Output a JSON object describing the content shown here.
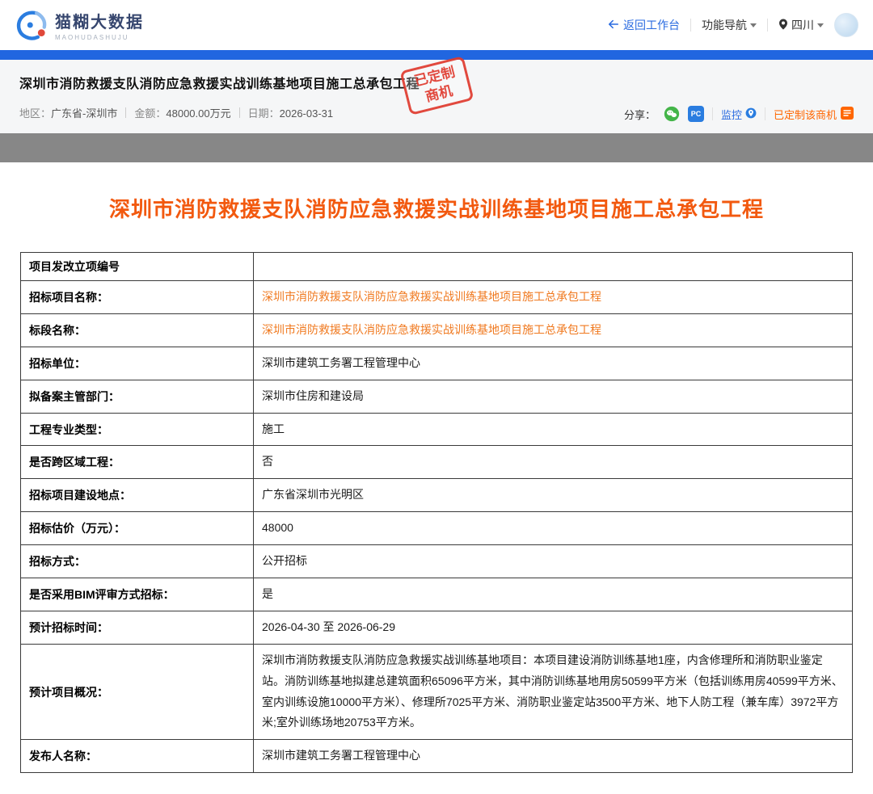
{
  "header": {
    "logo": {
      "title": "猫糊大数据",
      "subtitle": "MAOHUDASHUJU"
    },
    "nav": {
      "back_label": "返回工作台",
      "features_label": "功能导航",
      "region_label": "四川"
    }
  },
  "hero": {
    "title": "深圳市消防救援支队消防应急救援实战训练基地项目施工总承包工程",
    "stamp": {
      "line1": "已定制",
      "line2": "商机"
    },
    "meta": [
      {
        "label": "地区：",
        "value": "广东省-深圳市"
      },
      {
        "label": "金额：",
        "value": "48000.00万元"
      },
      {
        "label": "日期：",
        "value": "2026-03-31"
      }
    ],
    "share": {
      "label": "分享：",
      "pc_badge": "PC",
      "monitor_label": "监控",
      "customized_label": "已定制该商机"
    }
  },
  "main": {
    "title": "深圳市消防救援支队消防应急救援实战训练基地项目施工总承包工程",
    "table_rows": [
      {
        "label": "项目发改立项编号",
        "value": "",
        "link": false
      },
      {
        "label": "招标项目名称：",
        "value": "深圳市消防救援支队消防应急救援实战训练基地项目施工总承包工程",
        "link": true
      },
      {
        "label": "标段名称：",
        "value": "深圳市消防救援支队消防应急救援实战训练基地项目施工总承包工程",
        "link": true
      },
      {
        "label": "招标单位：",
        "value": "深圳市建筑工务署工程管理中心",
        "link": false
      },
      {
        "label": "拟备案主管部门：",
        "value": "深圳市住房和建设局",
        "link": false
      },
      {
        "label": "工程专业类型：",
        "value": "施工",
        "link": false
      },
      {
        "label": "是否跨区域工程：",
        "value": "否",
        "link": false
      },
      {
        "label": "招标项目建设地点：",
        "value": "广东省深圳市光明区",
        "link": false
      },
      {
        "label": "招标估价（万元）：",
        "value": "48000",
        "link": false
      },
      {
        "label": "招标方式：",
        "value": "公开招标",
        "link": false
      },
      {
        "label": "是否采用BIM评审方式招标：",
        "value": "是",
        "link": false
      },
      {
        "label": "预计招标时间：",
        "value": "2026-04-30 至 2026-06-29",
        "link": false
      },
      {
        "label": "预计项目概况：",
        "value": "深圳市消防救援支队消防应急救援实战训练基地项目：本项目建设消防训练基地1座，内含修理所和消防职业鉴定站。消防训练基地拟建总建筑面积65096平方米，其中消防训练基地用房50599平方米（包括训练用房40599平方米、室内训练设施10000平方米）、修理所7025平方米、消防职业鉴定站3500平方米、地下人防工程（兼车库）3972平方米;室外训练场地20753平方米。",
        "link": false
      },
      {
        "label": "发布人名称：",
        "value": "深圳市建筑工务署工程管理中心",
        "link": false
      }
    ]
  },
  "colors": {
    "accent_blue": "#2166e0",
    "title_orange": "#f2590f",
    "link_orange": "#f0791f",
    "stamp_red": "#e03b2f",
    "wechat_green": "#44b549"
  }
}
